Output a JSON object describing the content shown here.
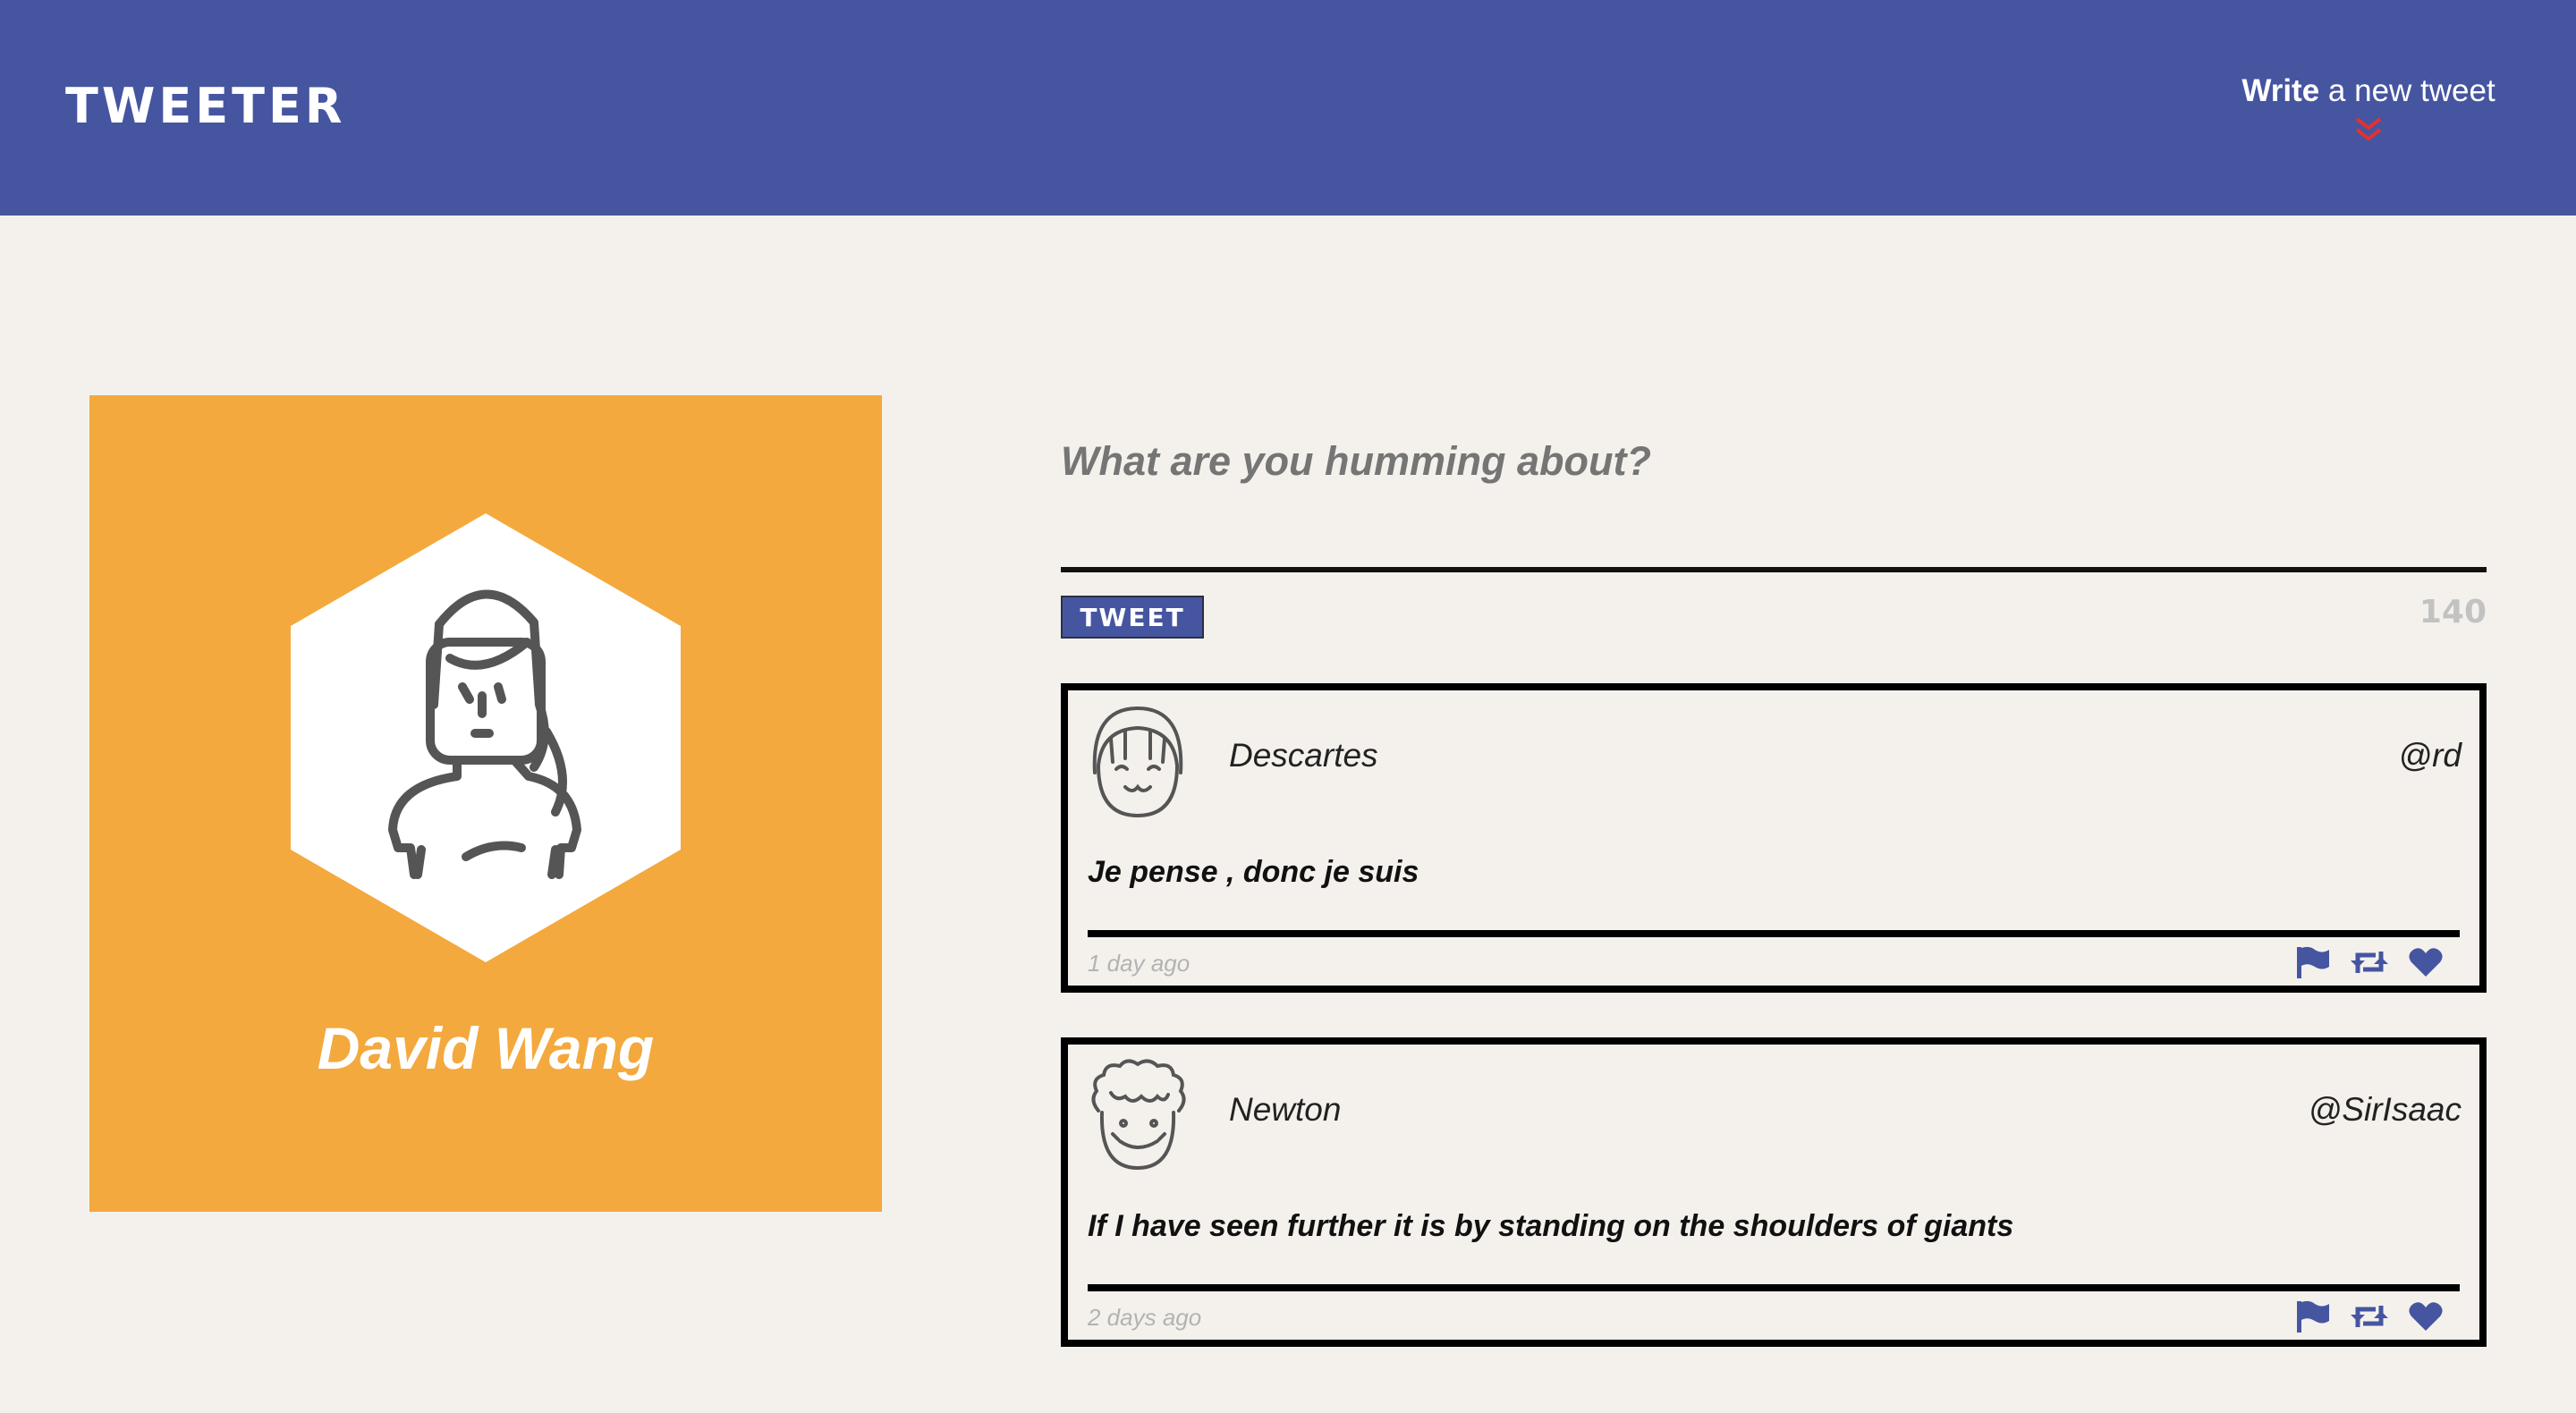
{
  "nav": {
    "brand": "TWEETER",
    "compose_bold": "Write",
    "compose_rest": " a new tweet"
  },
  "profile": {
    "name": "David Wang"
  },
  "composer": {
    "placeholder": "What are you humming about?",
    "button_label": "TWEET",
    "counter": "140"
  },
  "tweets": [
    {
      "name": "Descartes",
      "handle": "@rd",
      "text": "Je pense , donc je suis",
      "time": "1 day ago"
    },
    {
      "name": "Newton",
      "handle": "@SirIsaac",
      "text": "If I have seen further it is by standing on the shoulders of giants",
      "time": "2 days ago"
    }
  ],
  "colors": {
    "nav": "#4655a0",
    "profile_bg": "#f3a93d",
    "page_bg": "#f4f1ed",
    "accent_red": "#e2322e"
  },
  "icons": [
    "double-chevron-down-icon",
    "avatar-icon",
    "flag-icon",
    "retweet-icon",
    "heart-icon"
  ]
}
